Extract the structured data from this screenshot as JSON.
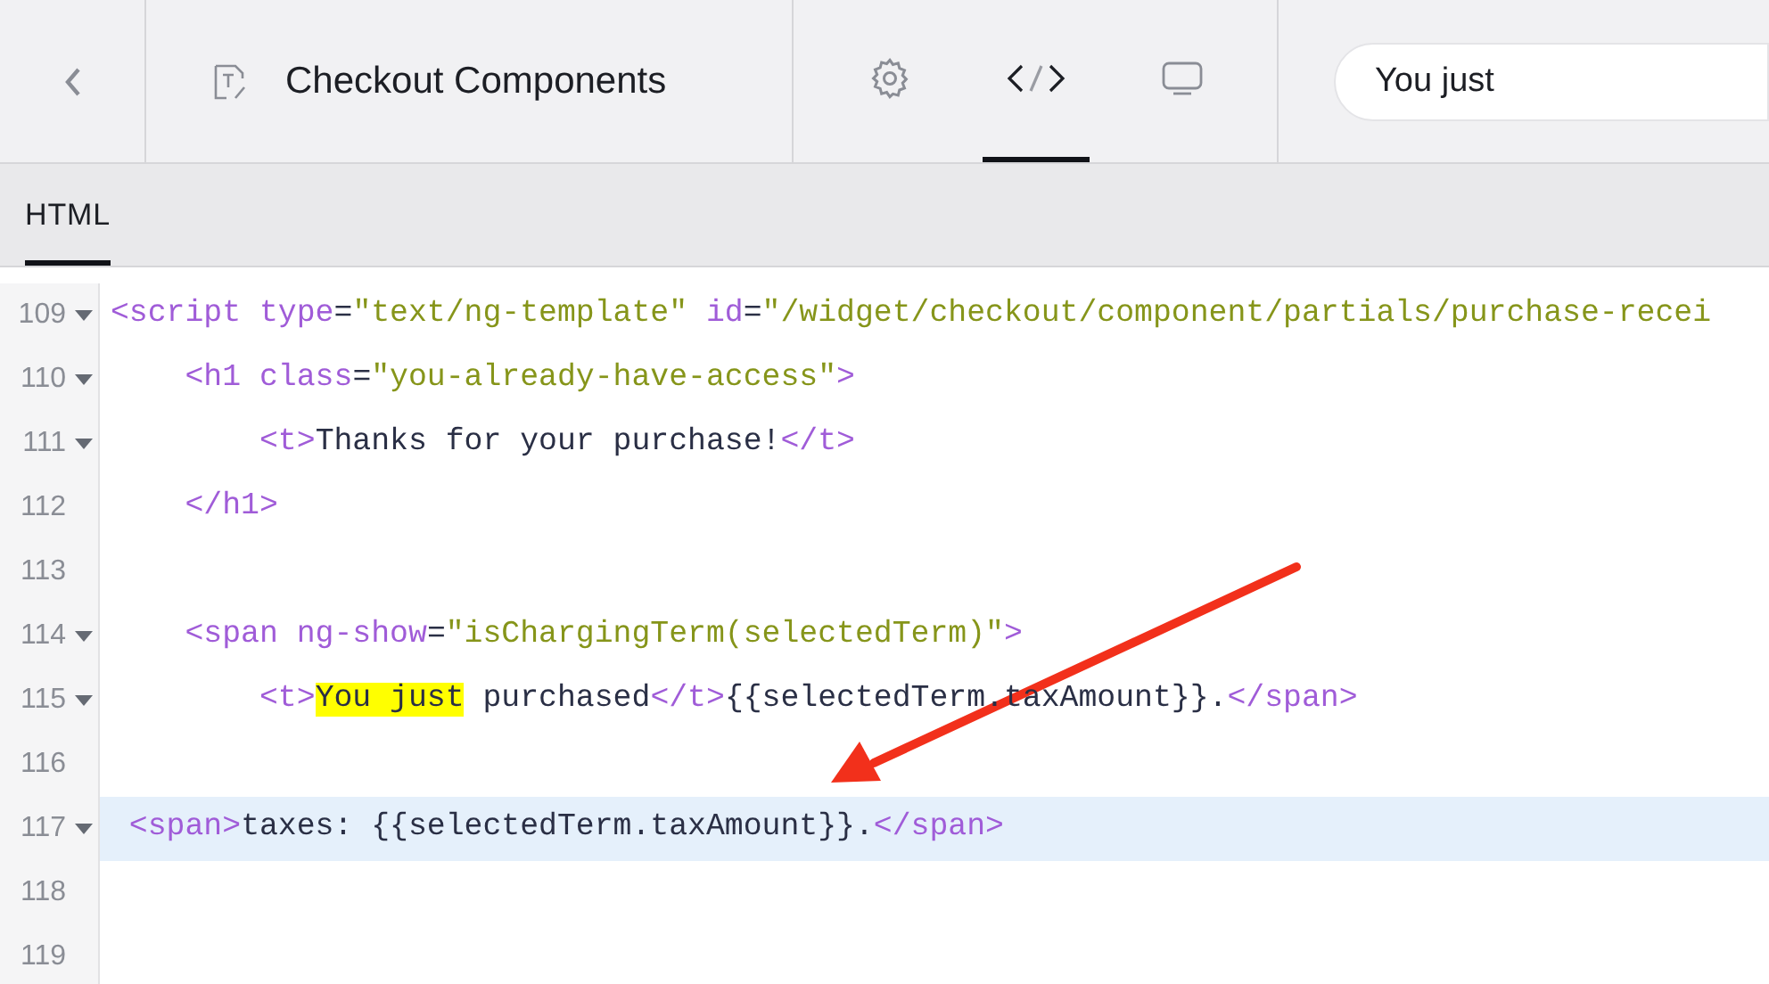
{
  "header": {
    "title": "Checkout Components"
  },
  "view_tabs": [
    {
      "kind": "settings",
      "selected": false
    },
    {
      "kind": "code",
      "selected": true
    },
    {
      "kind": "preview",
      "selected": false
    }
  ],
  "search": {
    "value": "You just"
  },
  "editor_tabs": [
    {
      "label": "HTML",
      "selected": true
    }
  ],
  "code_lines": [
    {
      "number": "109",
      "foldable": true,
      "highlighted": false,
      "tokens": [
        {
          "kind": "tag",
          "text": "<script"
        },
        {
          "kind": "attr",
          "text": " type"
        },
        {
          "kind": "punct",
          "text": "="
        },
        {
          "kind": "str",
          "text": "\"text/ng-template\""
        },
        {
          "kind": "attr",
          "text": " id"
        },
        {
          "kind": "punct",
          "text": "="
        },
        {
          "kind": "str",
          "text": "\"/widget/checkout/component/partials/purchase-recei"
        }
      ]
    },
    {
      "number": "110",
      "foldable": true,
      "highlighted": false,
      "tokens": [
        {
          "kind": "tag",
          "text": "    <h1"
        },
        {
          "kind": "attr",
          "text": " class"
        },
        {
          "kind": "punct",
          "text": "="
        },
        {
          "kind": "str",
          "text": "\"you-already-have-access\""
        },
        {
          "kind": "tag",
          "text": ">"
        }
      ]
    },
    {
      "number": "111",
      "foldable": true,
      "highlighted": false,
      "tokens": [
        {
          "kind": "tag",
          "text": "        <t>"
        },
        {
          "kind": "text",
          "text": "Thanks for your purchase!"
        },
        {
          "kind": "tag",
          "text": "</t>"
        }
      ]
    },
    {
      "number": "112",
      "foldable": false,
      "highlighted": false,
      "tokens": [
        {
          "kind": "tag",
          "text": "    </h1>"
        }
      ]
    },
    {
      "number": "113",
      "foldable": false,
      "highlighted": false
    },
    {
      "number": "114",
      "foldable": true,
      "highlighted": false,
      "tokens": [
        {
          "kind": "tag",
          "text": "    <span"
        },
        {
          "kind": "attr",
          "text": " ng-show"
        },
        {
          "kind": "punct",
          "text": "="
        },
        {
          "kind": "str",
          "text": "\"isChargingTerm(selectedTerm)\""
        },
        {
          "kind": "tag",
          "text": ">"
        }
      ]
    },
    {
      "number": "115",
      "foldable": true,
      "highlighted": false,
      "tokens": [
        {
          "kind": "tag",
          "text": "        <t>"
        },
        {
          "kind": "match",
          "text": "You just"
        },
        {
          "kind": "text",
          "text": " purchased"
        },
        {
          "kind": "tag",
          "text": "</t>"
        },
        {
          "kind": "text",
          "text": "{{selectedTerm.taxAmount}}."
        },
        {
          "kind": "tag",
          "text": "</span>"
        }
      ]
    },
    {
      "number": "116",
      "foldable": false,
      "highlighted": false
    },
    {
      "number": "117",
      "foldable": true,
      "highlighted": true,
      "tokens": [
        {
          "kind": "tag",
          "text": " <span>"
        },
        {
          "kind": "text",
          "text": "taxes: {{selectedTerm.taxAmount}}."
        },
        {
          "kind": "tag",
          "text": "</span>"
        }
      ]
    },
    {
      "number": "118",
      "foldable": false,
      "highlighted": false
    },
    {
      "number": "119",
      "foldable": false,
      "highlighted": false
    }
  ]
}
